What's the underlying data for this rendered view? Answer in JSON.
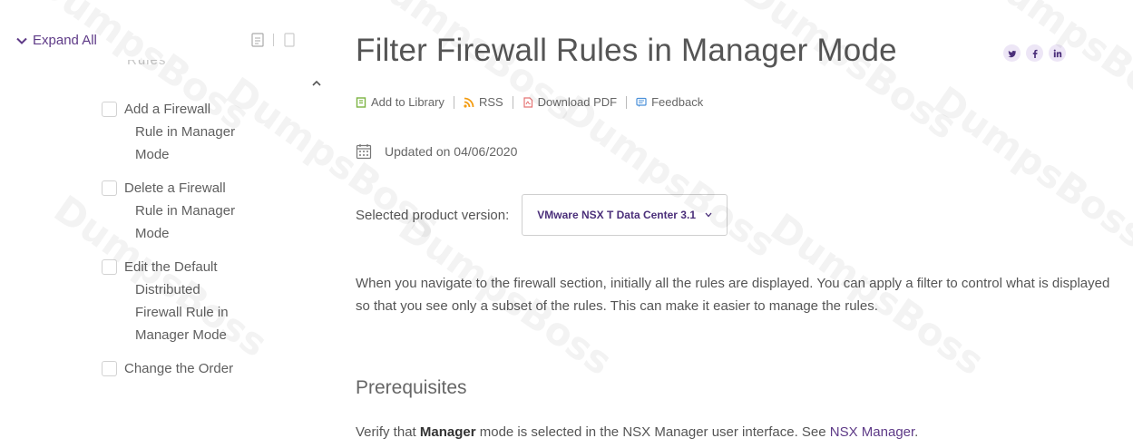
{
  "sidebar": {
    "expand_all": "Expand All",
    "truncated_label": "Rules",
    "items": [
      {
        "lines": [
          "Add a Firewall",
          "Rule in Manager",
          "Mode"
        ]
      },
      {
        "lines": [
          "Delete a Firewall",
          "Rule in Manager",
          "Mode"
        ]
      },
      {
        "lines": [
          "Edit the Default",
          "Distributed",
          "Firewall Rule in",
          "Manager Mode"
        ]
      },
      {
        "lines": [
          "Change the Order"
        ]
      }
    ]
  },
  "main": {
    "title": "Filter Firewall Rules in Manager Mode",
    "social": [
      "twitter-icon",
      "facebook-icon",
      "linkedin-icon"
    ],
    "actions": {
      "add_to_library": "Add to Library",
      "rss": "RSS",
      "download_pdf": "Download PDF",
      "feedback": "Feedback"
    },
    "updated": "Updated on 04/06/2020",
    "version_label": "Selected product version:",
    "version_value": "VMware NSX T Data Center 3.1",
    "intro": "When you navigate to the firewall section, initially all the rules are displayed. You can apply a filter to control what is displayed so that you see only a subset of the rules. This can make it easier to manage the rules.",
    "prereq_heading": "Prerequisites",
    "verify": {
      "prefix": "Verify that ",
      "bold": "Manager",
      "middle": " mode is selected in the NSX Manager user interface. See ",
      "link": "NSX Manager",
      "suffix": "."
    }
  },
  "watermark": "DumpsBoss",
  "colors": {
    "accent": "#5e3a87",
    "text": "#555555",
    "social_bg": "#ede6f6"
  }
}
